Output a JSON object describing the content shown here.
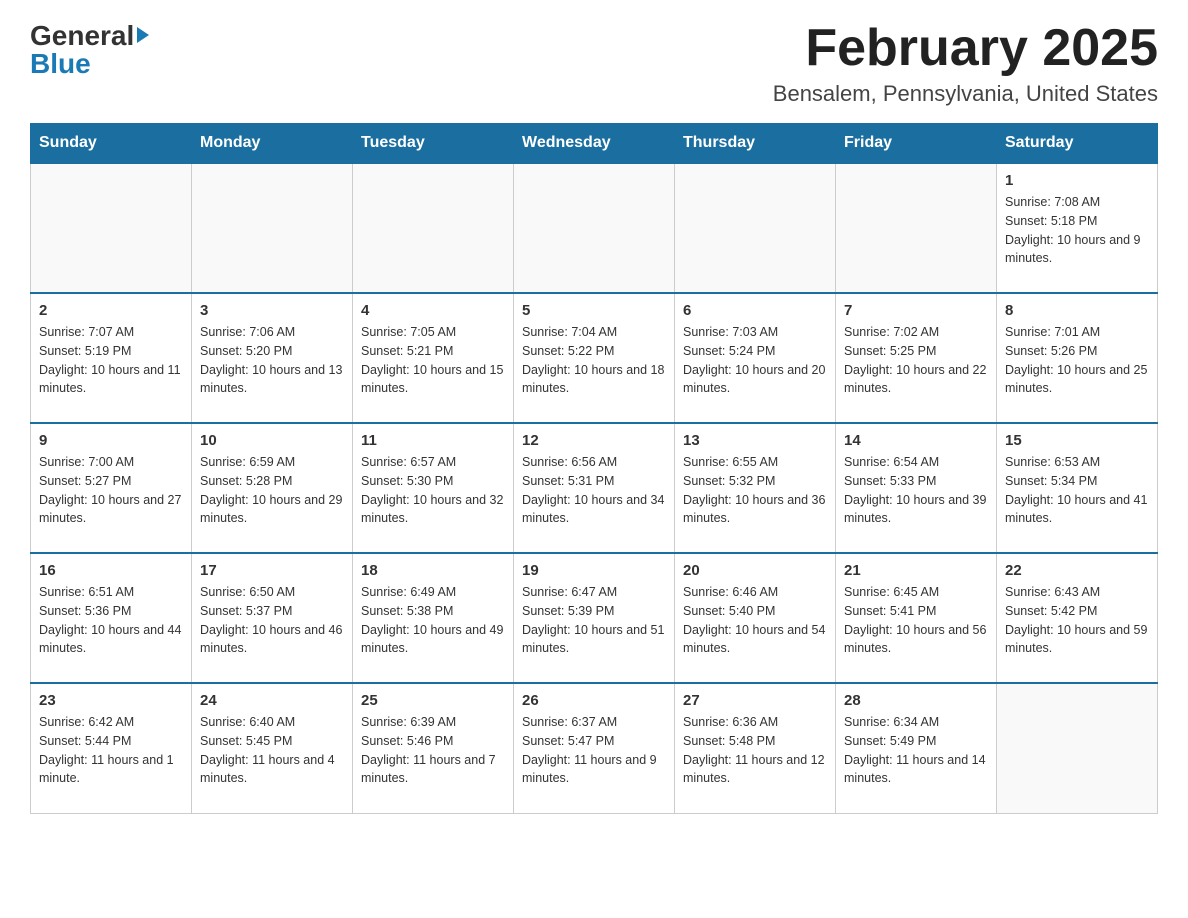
{
  "logo": {
    "line1": "General",
    "arrow": "▶",
    "line2": "Blue"
  },
  "title": "February 2025",
  "location": "Bensalem, Pennsylvania, United States",
  "weekdays": [
    "Sunday",
    "Monday",
    "Tuesday",
    "Wednesday",
    "Thursday",
    "Friday",
    "Saturday"
  ],
  "weeks": [
    [
      {
        "day": "",
        "info": ""
      },
      {
        "day": "",
        "info": ""
      },
      {
        "day": "",
        "info": ""
      },
      {
        "day": "",
        "info": ""
      },
      {
        "day": "",
        "info": ""
      },
      {
        "day": "",
        "info": ""
      },
      {
        "day": "1",
        "info": "Sunrise: 7:08 AM\nSunset: 5:18 PM\nDaylight: 10 hours and 9 minutes."
      }
    ],
    [
      {
        "day": "2",
        "info": "Sunrise: 7:07 AM\nSunset: 5:19 PM\nDaylight: 10 hours and 11 minutes."
      },
      {
        "day": "3",
        "info": "Sunrise: 7:06 AM\nSunset: 5:20 PM\nDaylight: 10 hours and 13 minutes."
      },
      {
        "day": "4",
        "info": "Sunrise: 7:05 AM\nSunset: 5:21 PM\nDaylight: 10 hours and 15 minutes."
      },
      {
        "day": "5",
        "info": "Sunrise: 7:04 AM\nSunset: 5:22 PM\nDaylight: 10 hours and 18 minutes."
      },
      {
        "day": "6",
        "info": "Sunrise: 7:03 AM\nSunset: 5:24 PM\nDaylight: 10 hours and 20 minutes."
      },
      {
        "day": "7",
        "info": "Sunrise: 7:02 AM\nSunset: 5:25 PM\nDaylight: 10 hours and 22 minutes."
      },
      {
        "day": "8",
        "info": "Sunrise: 7:01 AM\nSunset: 5:26 PM\nDaylight: 10 hours and 25 minutes."
      }
    ],
    [
      {
        "day": "9",
        "info": "Sunrise: 7:00 AM\nSunset: 5:27 PM\nDaylight: 10 hours and 27 minutes."
      },
      {
        "day": "10",
        "info": "Sunrise: 6:59 AM\nSunset: 5:28 PM\nDaylight: 10 hours and 29 minutes."
      },
      {
        "day": "11",
        "info": "Sunrise: 6:57 AM\nSunset: 5:30 PM\nDaylight: 10 hours and 32 minutes."
      },
      {
        "day": "12",
        "info": "Sunrise: 6:56 AM\nSunset: 5:31 PM\nDaylight: 10 hours and 34 minutes."
      },
      {
        "day": "13",
        "info": "Sunrise: 6:55 AM\nSunset: 5:32 PM\nDaylight: 10 hours and 36 minutes."
      },
      {
        "day": "14",
        "info": "Sunrise: 6:54 AM\nSunset: 5:33 PM\nDaylight: 10 hours and 39 minutes."
      },
      {
        "day": "15",
        "info": "Sunrise: 6:53 AM\nSunset: 5:34 PM\nDaylight: 10 hours and 41 minutes."
      }
    ],
    [
      {
        "day": "16",
        "info": "Sunrise: 6:51 AM\nSunset: 5:36 PM\nDaylight: 10 hours and 44 minutes."
      },
      {
        "day": "17",
        "info": "Sunrise: 6:50 AM\nSunset: 5:37 PM\nDaylight: 10 hours and 46 minutes."
      },
      {
        "day": "18",
        "info": "Sunrise: 6:49 AM\nSunset: 5:38 PM\nDaylight: 10 hours and 49 minutes."
      },
      {
        "day": "19",
        "info": "Sunrise: 6:47 AM\nSunset: 5:39 PM\nDaylight: 10 hours and 51 minutes."
      },
      {
        "day": "20",
        "info": "Sunrise: 6:46 AM\nSunset: 5:40 PM\nDaylight: 10 hours and 54 minutes."
      },
      {
        "day": "21",
        "info": "Sunrise: 6:45 AM\nSunset: 5:41 PM\nDaylight: 10 hours and 56 minutes."
      },
      {
        "day": "22",
        "info": "Sunrise: 6:43 AM\nSunset: 5:42 PM\nDaylight: 10 hours and 59 minutes."
      }
    ],
    [
      {
        "day": "23",
        "info": "Sunrise: 6:42 AM\nSunset: 5:44 PM\nDaylight: 11 hours and 1 minute."
      },
      {
        "day": "24",
        "info": "Sunrise: 6:40 AM\nSunset: 5:45 PM\nDaylight: 11 hours and 4 minutes."
      },
      {
        "day": "25",
        "info": "Sunrise: 6:39 AM\nSunset: 5:46 PM\nDaylight: 11 hours and 7 minutes."
      },
      {
        "day": "26",
        "info": "Sunrise: 6:37 AM\nSunset: 5:47 PM\nDaylight: 11 hours and 9 minutes."
      },
      {
        "day": "27",
        "info": "Sunrise: 6:36 AM\nSunset: 5:48 PM\nDaylight: 11 hours and 12 minutes."
      },
      {
        "day": "28",
        "info": "Sunrise: 6:34 AM\nSunset: 5:49 PM\nDaylight: 11 hours and 14 minutes."
      },
      {
        "day": "",
        "info": ""
      }
    ]
  ]
}
